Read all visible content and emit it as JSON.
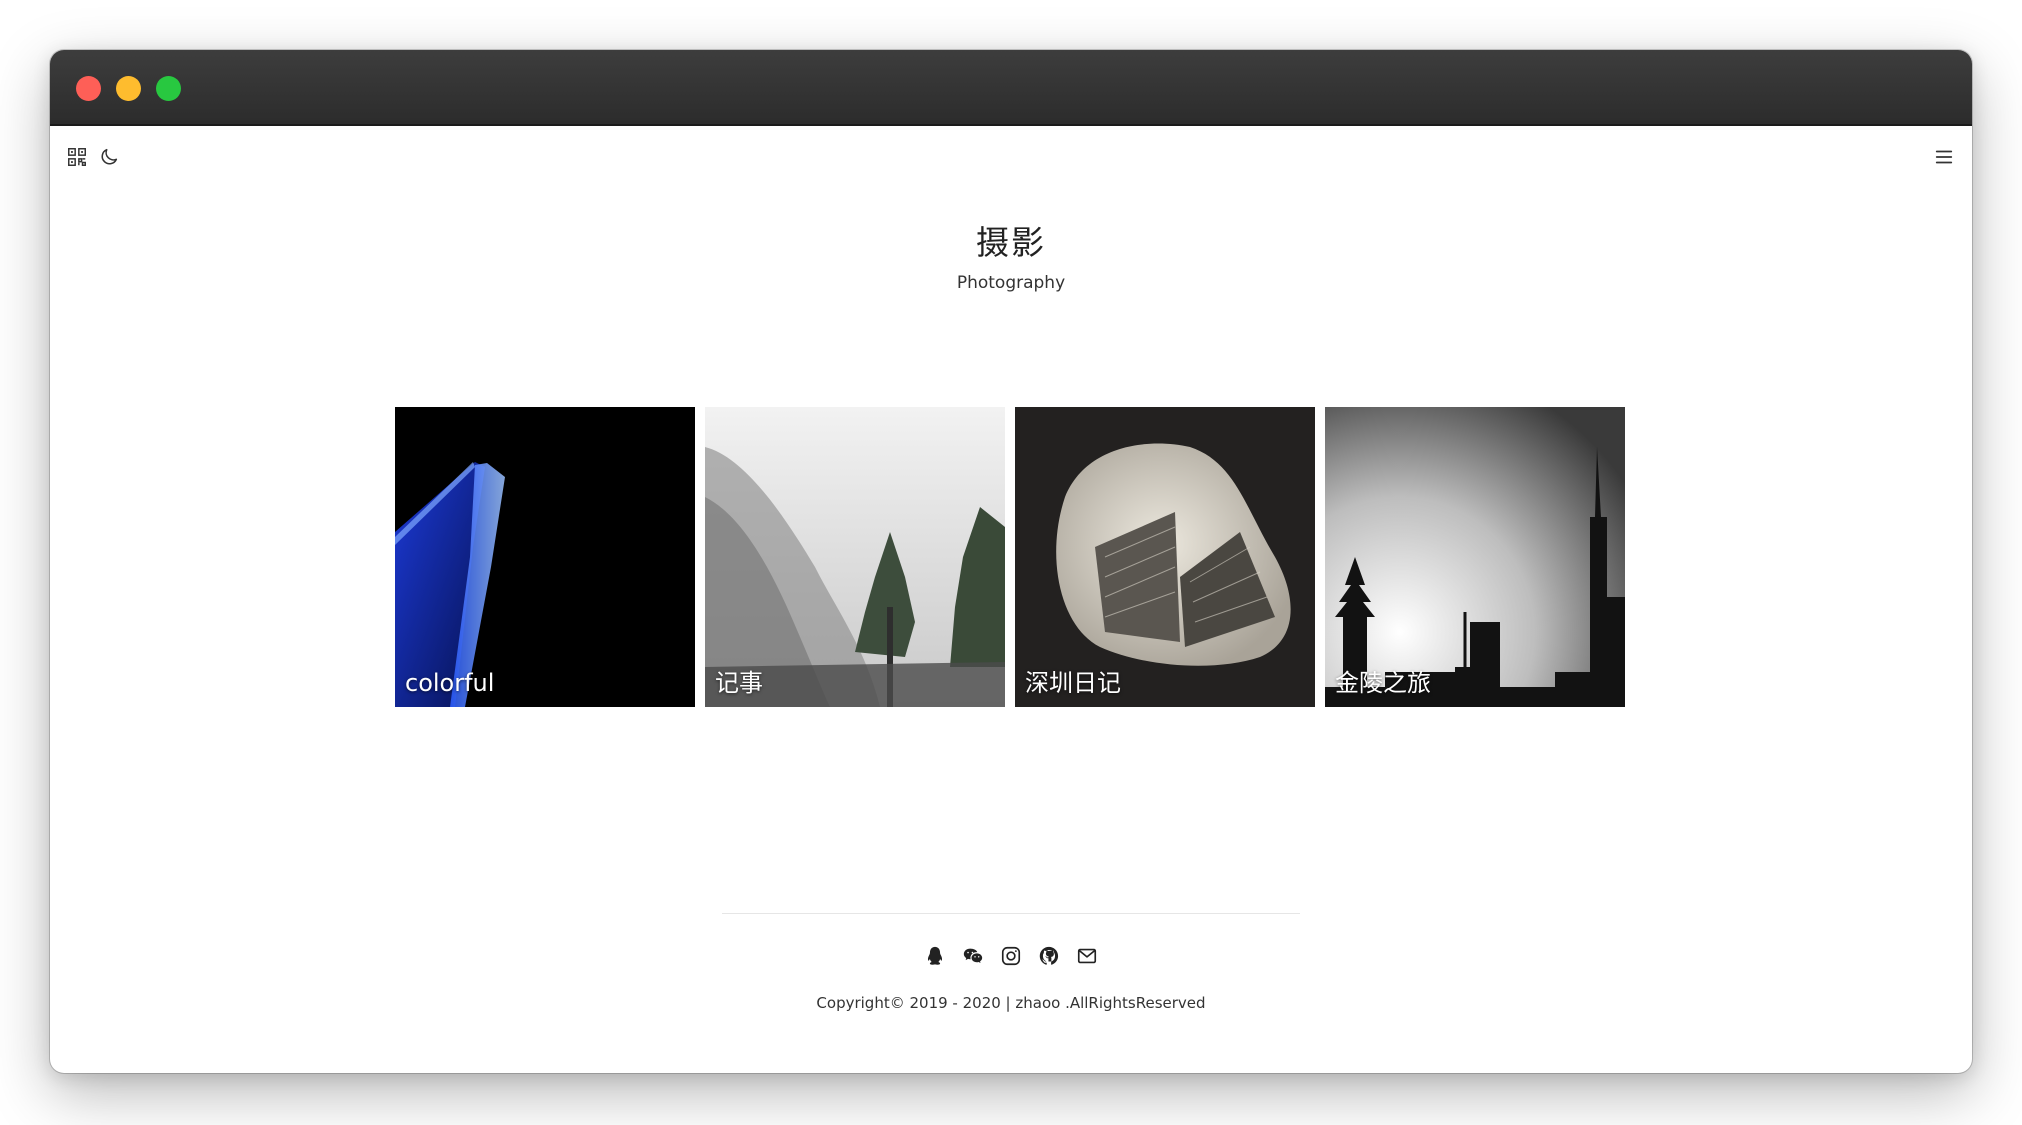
{
  "window": {
    "controls": [
      "close",
      "minimize",
      "maximize"
    ]
  },
  "toolbar": {
    "left_icons": [
      "qrcode-icon",
      "moon-icon"
    ],
    "right_icons": [
      "menu-icon"
    ]
  },
  "header": {
    "title": "摄影",
    "subtitle": "Photography"
  },
  "albums": [
    {
      "label": "colorful"
    },
    {
      "label": "记事"
    },
    {
      "label": "深圳日记"
    },
    {
      "label": "金陵之旅"
    }
  ],
  "footer": {
    "social_icons": [
      "qq-icon",
      "wechat-icon",
      "instagram-icon",
      "github-icon",
      "email-icon"
    ],
    "copyright": "Copyright© 2019 - 2020 | zhaoo .AllRightsReserved"
  },
  "colors": {
    "titlebar": "#2c2c2c",
    "close": "#fe5f57",
    "minimize": "#febc2e",
    "maximize": "#28c840",
    "text": "#222222"
  }
}
